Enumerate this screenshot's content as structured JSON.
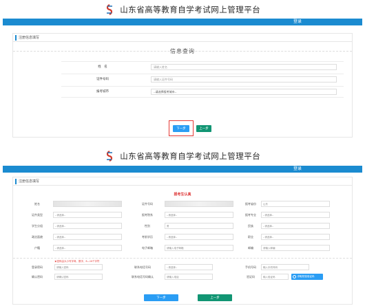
{
  "brand_title": "山东省高等教育自学考试网上管理平台",
  "top_nav": {
    "login": "登录"
  },
  "section_title": "注册信息填写",
  "step1": {
    "heading": "信息查询",
    "fields": [
      {
        "label": "姓　名",
        "placeholder": "请输入姓名"
      },
      {
        "label": "证件号码",
        "placeholder": "请输入证件号码"
      },
      {
        "label": "报考城市",
        "value": "--请选择报考城市--"
      }
    ],
    "buttons": {
      "next": "下一步",
      "prev": "上一步"
    }
  },
  "step2": {
    "heading": "报考生认真",
    "rows": [
      [
        {
          "label": "姓名",
          "value": "",
          "blurred": true
        },
        {
          "label": "证件号码",
          "value": "",
          "blurred": true
        },
        {
          "label": "报考省份",
          "value": "山东"
        }
      ],
      [
        {
          "label": "证件类型",
          "value": "--请选择--"
        },
        {
          "label": "报考院系",
          "value": "--请选择--"
        },
        {
          "label": "报考专业",
          "value": "--请选择--"
        }
      ],
      [
        {
          "label": "学生分组",
          "value": "--请选择--"
        },
        {
          "label": "性别",
          "value": "男"
        },
        {
          "label": "民族",
          "value": "--请选择--"
        }
      ],
      [
        {
          "label": "政治面貌",
          "value": "--请选择--"
        },
        {
          "label": "考前学历",
          "value": "--请选择--"
        },
        {
          "label": "职业",
          "value": "--请选择--"
        }
      ],
      [
        {
          "label": "户籍",
          "value": "--请选择--"
        },
        {
          "label": "电子邮箱",
          "value": "请输入电子邮箱"
        },
        {
          "label": "邮编",
          "value": "请输入邮编"
        }
      ]
    ],
    "password_tip": "★密码由大小写字母、数字、8—16个字符",
    "password": {
      "label": "登录密码",
      "placeholder": "请输入密码"
    },
    "confirm": {
      "label": "确认密码",
      "placeholder": "请确认密码"
    },
    "phone": {
      "label": "联系电话号码",
      "value": "--请选择--"
    },
    "phone_confirm": {
      "label": "联系电话号码确认",
      "placeholder": "请输入电话"
    },
    "mobile": {
      "label": "手机号码",
      "placeholder": "输入手机号码"
    },
    "sms": {
      "label": "验证码",
      "placeholder": "输入验证码"
    },
    "face_button": "获取短信验证码",
    "buttons": {
      "next": "下一步",
      "prev": "上一步"
    }
  }
}
